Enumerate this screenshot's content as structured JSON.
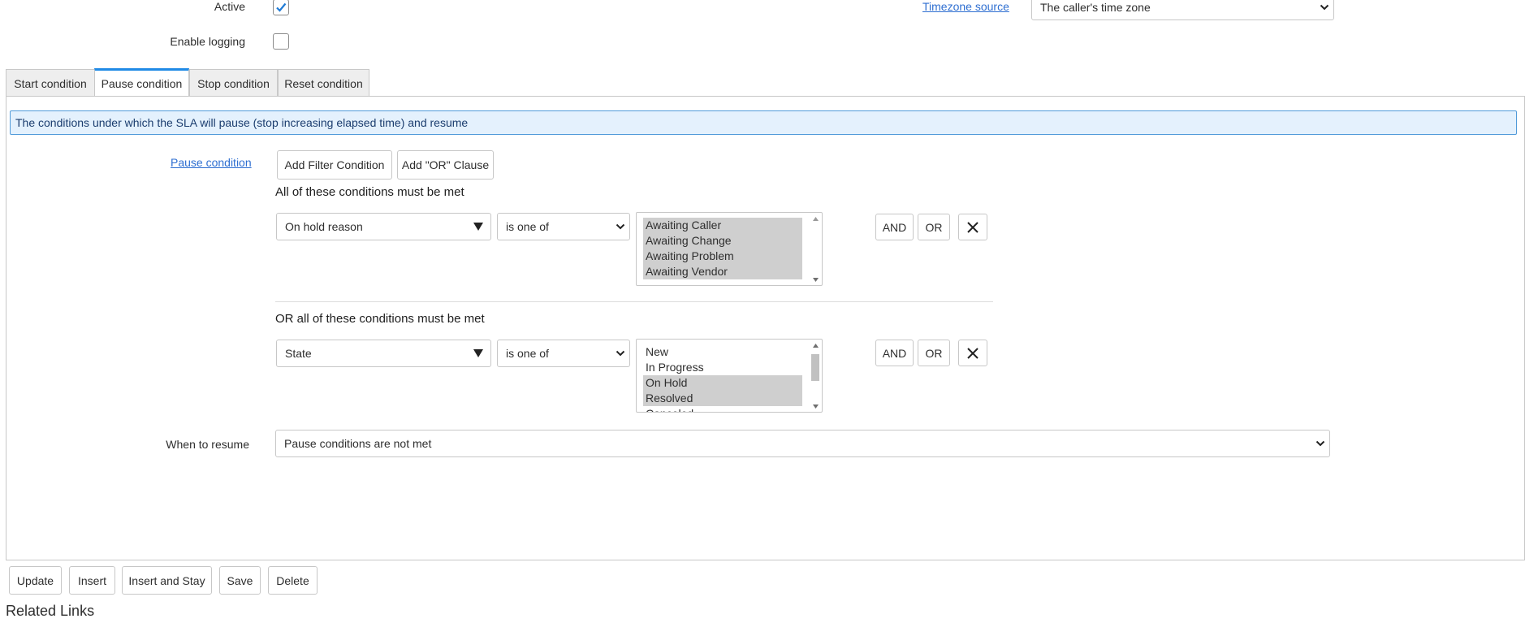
{
  "form": {
    "active_label": "Active",
    "active_checked": true,
    "enable_logging_label": "Enable logging",
    "enable_logging_checked": false,
    "timezone_source_label": "Timezone source",
    "timezone_source_value": "The caller's time zone"
  },
  "tabs": [
    {
      "label": "Start condition",
      "active": false
    },
    {
      "label": "Pause condition",
      "active": true
    },
    {
      "label": "Stop condition",
      "active": false
    },
    {
      "label": "Reset condition",
      "active": false
    }
  ],
  "panel": {
    "info_text": "The conditions under which the SLA will pause (stop increasing elapsed time) and resume",
    "pause_condition_label": "Pause condition",
    "add_filter_label": "Add Filter Condition",
    "add_or_label": "Add \"OR\" Clause",
    "group1": {
      "title": "All of these conditions must be met",
      "field": "On hold reason",
      "operator": "is one of",
      "options": [
        {
          "label": "Awaiting Caller",
          "selected": true
        },
        {
          "label": "Awaiting Change",
          "selected": true
        },
        {
          "label": "Awaiting Problem",
          "selected": true
        },
        {
          "label": "Awaiting Vendor",
          "selected": true
        }
      ]
    },
    "group2": {
      "title": "OR all of these conditions must be met",
      "field": "State",
      "operator": "is one of",
      "options": [
        {
          "label": "New",
          "selected": false
        },
        {
          "label": "In Progress",
          "selected": false
        },
        {
          "label": "On Hold",
          "selected": true
        },
        {
          "label": "Resolved",
          "selected": true
        },
        {
          "label": "Canceled",
          "selected": false
        }
      ]
    },
    "and_label": "AND",
    "or_label": "OR",
    "when_to_resume_label": "When to resume",
    "when_to_resume_value": "Pause conditions are not met"
  },
  "actions": {
    "update": "Update",
    "insert": "Insert",
    "insert_and_stay": "Insert and Stay",
    "save": "Save",
    "delete": "Delete"
  },
  "related_links": "Related Links",
  "colors": {
    "accent": "#1f8ae6",
    "link": "#2f6fd1",
    "info_bg": "#e4f1fd",
    "selected_option": "#cfcfcf"
  }
}
